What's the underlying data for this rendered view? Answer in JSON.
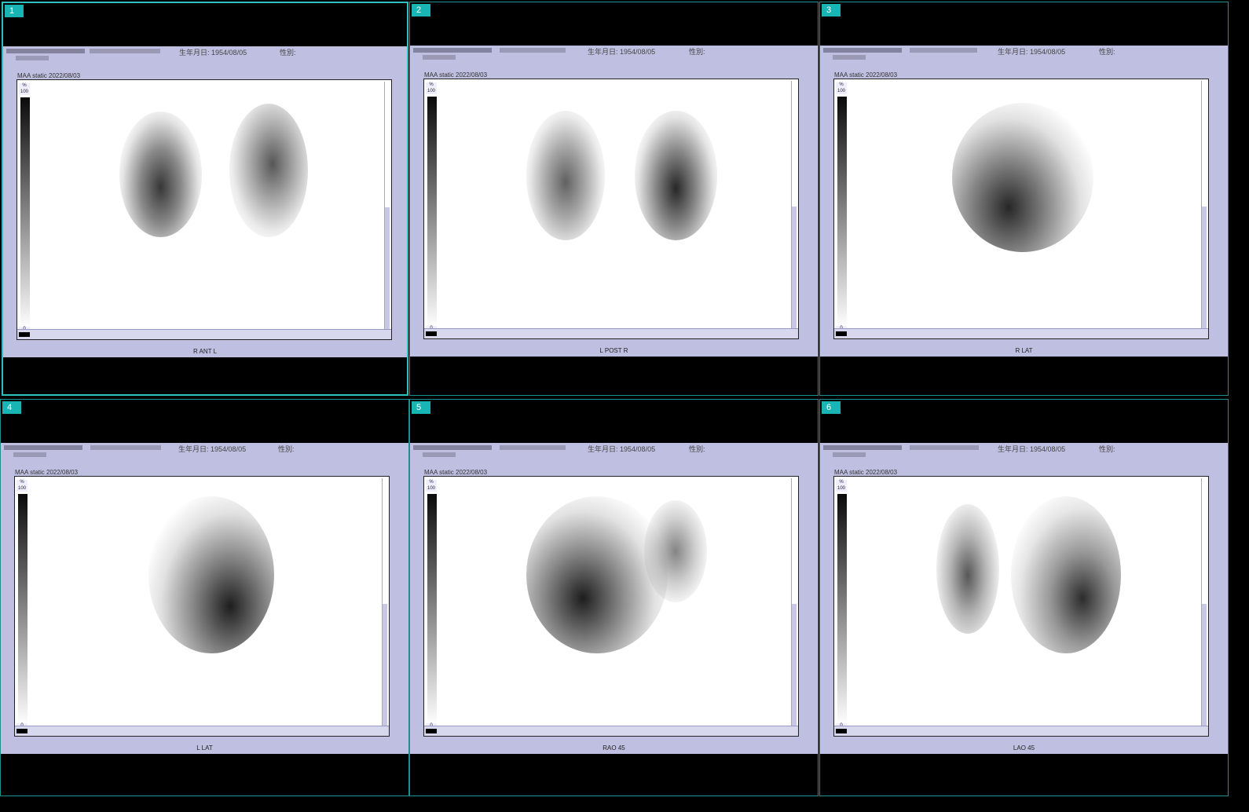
{
  "header_fields": {
    "dob_label": "生年月日",
    "dob_value": "1954/08/05",
    "sex_label": "性別"
  },
  "panels": [
    {
      "number": "1",
      "study": "MAA static 2022/08/03",
      "view": "R ANT L",
      "selected": true
    },
    {
      "number": "2",
      "study": "MAA static 2022/08/03",
      "view": "L POST R",
      "selected": false
    },
    {
      "number": "3",
      "study": "MAA static 2022/08/03",
      "view": "R LAT",
      "selected": false
    },
    {
      "number": "4",
      "study": "MAA static 2022/08/03",
      "view": "L LAT",
      "selected": false
    },
    {
      "number": "5",
      "study": "MAA static 2022/08/03",
      "view": "RAO 45",
      "selected": false
    },
    {
      "number": "6",
      "study": "MAA static 2022/08/03",
      "view": "LAO 45",
      "selected": false
    }
  ],
  "colorbar": {
    "top_label": "%",
    "max": "100",
    "min": "0"
  },
  "colors": {
    "grid_border": "#1c8f8f",
    "selected_border": "#2cc0c0",
    "panel_number_bg": "#19b5b5",
    "sheet_bg": "#bfbfe1"
  }
}
